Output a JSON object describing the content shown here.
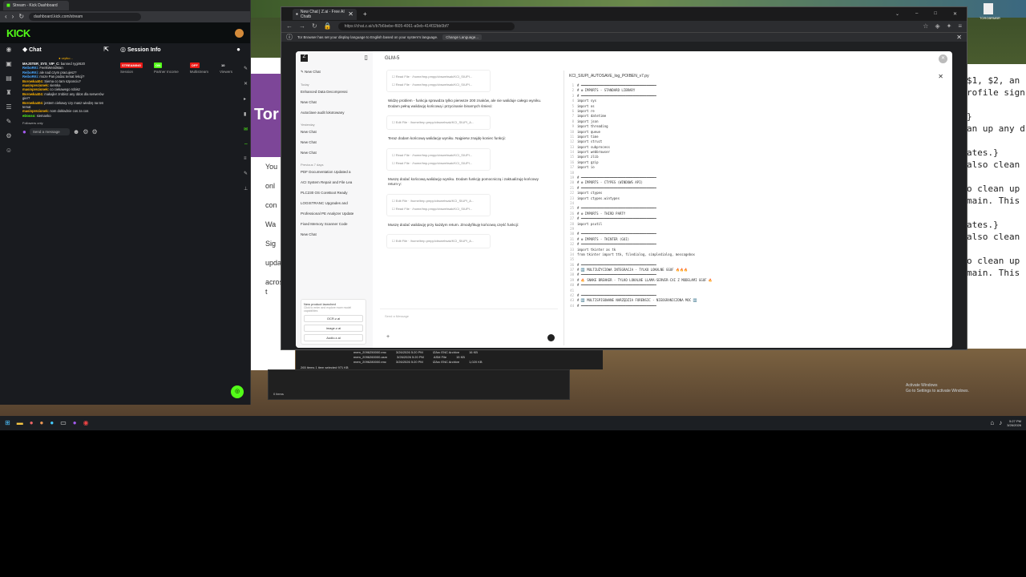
{
  "kick": {
    "tab_title": "Stream - Kick Dashboard",
    "url": "dashboard.kick.com/stream",
    "logo": "KICK",
    "chat": {
      "title": "Chat",
      "pinned_user": "urytko...",
      "messages": [
        {
          "user": "MAJSTER_SYS_VIP_C",
          "text": "banned rygir620",
          "color": "#ffffff"
        },
        {
          "user": "ReiboRKi",
          "text": "FeelsWeirdMan",
          "color": "#4aa8ff"
        },
        {
          "user": "ReiboRKi",
          "text": "ale nad czym pracujesz?",
          "color": "#4aa8ff"
        },
        {
          "user": "ReiboRKi",
          "text": "moze Pan podac temat lekcji?",
          "color": "#4aa8ff"
        },
        {
          "user": "Borowka404",
          "text": "Siema co tam szponciu?",
          "color": "#ffb400"
        },
        {
          "user": "masinprezionek",
          "text": "siemka",
          "color": "#ffb400"
        },
        {
          "user": "masinprezionek",
          "text": "co ciekawego robisz",
          "color": "#ffb400"
        },
        {
          "user": "Borowka404",
          "text": "makajler zrobisz any ddos dla serwerów gier?",
          "color": "#ffb400"
        },
        {
          "user": "Borowka404",
          "text": "jestem ciekawy czy masz wiedzę na ten temat",
          "color": "#ffb400"
        },
        {
          "user": "masinprezionek",
          "text": "nom dokładnie cos za cos",
          "color": "#ffb400"
        },
        {
          "user": "eDosso",
          "text": "siemanko",
          "color": "#53fc18"
        }
      ],
      "followers_only": "Followers only",
      "input_placeholder": "Send a message"
    },
    "session": {
      "title": "Session Info",
      "stats": [
        {
          "badge": "STREAMING",
          "badge_color": "#e91916",
          "label": "Session"
        },
        {
          "badge": "ON",
          "badge_color": "#53fc18",
          "label": "Partner Income"
        },
        {
          "badge": "OFF",
          "badge_color": "#e91916",
          "label": "Multistream"
        },
        {
          "badge": "10",
          "badge_color": "transparent",
          "label": "Viewers"
        }
      ]
    }
  },
  "zai": {
    "tab_title": "New Chat | Z.ai - Free AI Chatb",
    "url": "https://chat.z.ai/c/b7b6bebe-f605-4061-a0eb-414f32bb0bf7",
    "infobar_text": "Tor Browser has set your display language to English based on your system's language.",
    "infobar_button": "Change Language...",
    "sidebar": {
      "new_chat": "New Chat",
      "today": "Today",
      "today_items": [
        "Enhanced Data Decompressi",
        "New Chat",
        "Autoclave audit lokotowany"
      ],
      "yesterday": "Yesterday",
      "yesterday_items": [
        "New Chat",
        "New Chat",
        "New Chat"
      ],
      "previous": "Previous 7 days",
      "previous_items": [
        "PDF Documentation Updated a",
        "ACI System Repair and File Lea",
        "PLC230 OS CoreBoot Ready",
        "LOGISTRANC Upgrades and ",
        "Professional PE Analyzer Update",
        "Fixed Memory Scanner Code",
        "New Chat"
      ],
      "promo_title": "New product launched",
      "promo_text": "Click to enter and explore more model capabilities",
      "promo_buttons": [
        "OCR.z.ai",
        "image.z.ai",
        "Audio.z.ai"
      ]
    },
    "main": {
      "model": "GLM-5",
      "blocks": [
        {
          "type": "tool",
          "items": [
            "Read File · /home/tmp.pmpp/cbswehsak/KCI_SIUPI...",
            "Read File · /home/tmp.pmpp/cbswehsak/KCI_SIUPI..."
          ]
        },
        {
          "type": "text",
          "text": "Widzę problem - funkcja sprawdza tylko pierwsze 200 znaków, ale nie waliduje całego wyniku. Dodam pełną walidację końcową i przycinanie binarnych śmieci:"
        },
        {
          "type": "tool",
          "items": [
            "Edit File · /home/tmp.pmpp/cbswehsak/KCI_SIUPI_A..."
          ]
        },
        {
          "type": "text",
          "text": "Teraz dodam końcową walidację wyniku. Najpierw znajdę koniec funkcji:"
        },
        {
          "type": "tool",
          "items": [
            "Read File · /home/tmp.pmpp/cbswehsak/KCI_SIUPI...",
            "Read File · /home/tmp.pmpp/cbswehsak/KCI_SIUPI..."
          ]
        },
        {
          "type": "text",
          "text": "Muszę dodać końcową walidację wyniku. Dodam funkcję pomocniczą i zaktualizuję końcowy return-y:"
        },
        {
          "type": "tool",
          "items": [
            "Edit File · /home/tmp.pmpp/cbswehsak/KCI_SIUPI_A...",
            "Read File · /home/tmp.pmpp/cbswehsak/KCI_SIUPI..."
          ]
        },
        {
          "type": "text",
          "text": "Muszę dodać walidację przy każdym return. Zmodyfikuję końcową część funkcji:"
        },
        {
          "type": "tool",
          "items": [
            "Edit File · /home/tmp.pmpp/cbswehsak/KCI_SIUPI_A..."
          ]
        }
      ],
      "input_placeholder": "Send a Message"
    },
    "code": {
      "title": "KCI_SIUPI_AUTOSAVE_log_POIBEN_v7.py",
      "lines": [
        "# ═══════════════════════════════════════",
        "# ⚙ IMPORTS - STANDARD LIBRARY",
        "# ═══════════════════════════════════════",
        "import sys",
        "import os",
        "import re",
        "import datetime",
        "import json",
        "import threading",
        "import queue",
        "import time",
        "import struct",
        "import subprocess",
        "import webbrowser",
        "import zlib",
        "import gzip",
        "import io",
        "",
        "# ═══════════════════════════════════════",
        "# ⚙ IMPORTS - CTYPES (WINDOWS API)",
        "# ═══════════════════════════════════════",
        "import ctypes",
        "import ctypes.wintypes",
        "",
        "# ═══════════════════════════════════════",
        "# ⚙ IMPORTS - THIRD PARTY",
        "# ═══════════════════════════════════════",
        "import psutil",
        "",
        "# ═══════════════════════════════════════",
        "# ⚙ IMPORTS - TKINTER (GUI)",
        "# ═══════════════════════════════════════",
        "import tkinter as tk",
        "from tkinter import ttk, filedialog, simpledialog, messagebox",
        "",
        "# ═══════════════════════════════════════",
        "# 🆕 MULTIUŻYCIOWA INTEGRACJA - TYLKO LOKALNE GGUF 🔥🔥🔥",
        "# ═══════════════════════════════════════",
        "# 🔥 SNAKE BREAKER - TYLKO LOKALNE LLAMA-SERVER-CXI Z MODELAMI GGUF 🔥",
        "# ═══════════════════════════════════════",
        "",
        "# ═══════════════════════════════════════",
        "# 🆕 MULTISPISOWANE NARZĘDZIA FORENSIC - NIEOGRANICZONA MOC 🆕",
        "# ═══════════════════════════════════════"
      ]
    }
  },
  "background": {
    "web_hero": "Tor",
    "web_texts": [
      "You",
      "onl",
      "con",
      "Wa",
      "Sig",
      "updates",
      "across t"
    ],
    "terminal_lines": [
      "$1, $2, an",
      "rofile sign",
      "",
      "}",
      "an up any d",
      "",
      "ates.}",
      "also clean",
      "",
      "o clean up",
      "main. This",
      "",
      "ates.}",
      "also clean",
      "",
      "o clean up",
      "main. This"
    ]
  },
  "explorer": {
    "files": [
      {
        "name": "mem_2096250000.enc",
        "date": "3/26/2026 5:20 PM",
        "type": "IZArc ENC Archive",
        "size": "16 KB"
      },
      {
        "name": "mem_2096260000.asm",
        "date": "3/26/2026 5:20 PM",
        "type": "ASM File",
        "size": "15 KB"
      },
      {
        "name": "mem_2096280000.enc",
        "date": "3/26/2026 5:20 PM",
        "type": "IZArc ENC Archive",
        "size": "1,020 KB"
      }
    ],
    "status": "265 items  1 item selected  971 KB",
    "status2": "0 items"
  },
  "desktop": {
    "icon_label": "TORGBRMBR",
    "activate_title": "Activate Windows",
    "activate_sub": "Go to Settings to activate Windows.",
    "clock_time": "5:27 PM",
    "clock_date": "3/26/2026"
  }
}
